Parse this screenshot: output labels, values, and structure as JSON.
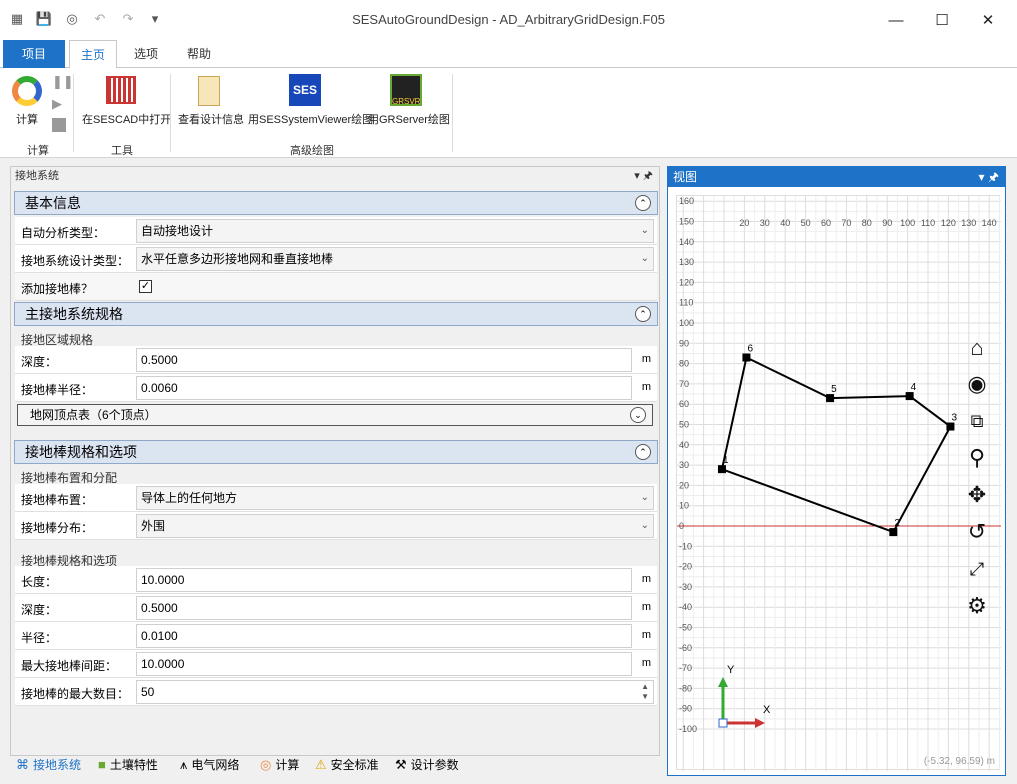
{
  "window": {
    "title": "SESAutoGroundDesign - AD_ArbitraryGridDesign.F05",
    "qa_icons": [
      "app-icon",
      "save-icon",
      "color-wheel-icon",
      "undo-icon",
      "redo-icon",
      "dropdown-icon"
    ],
    "controls": [
      "minimize",
      "maximize",
      "close"
    ]
  },
  "tabs": [
    {
      "label": "项目"
    },
    {
      "label": "主页"
    },
    {
      "label": "选项"
    },
    {
      "label": "帮助"
    }
  ],
  "ribbon": {
    "groups": [
      {
        "label": "计算",
        "buttons": [
          {
            "label": "计算"
          }
        ]
      },
      {
        "label": "工具",
        "buttons": [
          {
            "label": "在SESCAD中打开"
          }
        ]
      },
      {
        "label": "高级绘图",
        "buttons": [
          {
            "label": "查看设计信息"
          },
          {
            "label": "用SESSystemViewer绘图"
          },
          {
            "label": "用GRServer绘图"
          }
        ]
      }
    ]
  },
  "left_panel": {
    "title": "接地系统",
    "basic": {
      "title": "基本信息",
      "rows": [
        {
          "label": "自动分析类型：",
          "value": "自动接地设计"
        },
        {
          "label": "接地系统设计类型：",
          "value": "水平任意多边形接地网和垂直接地棒"
        },
        {
          "label": "添加接地棒？",
          "checked": true
        }
      ]
    },
    "main": {
      "title": "主接地系统规格",
      "subtitle": "接地区域规格",
      "rows": [
        {
          "label": "深度：",
          "value": "0.5000",
          "unit": "m"
        },
        {
          "label": "接地棒半径：",
          "value": "0.0060",
          "unit": "m"
        }
      ],
      "vertex_table": "地网顶点表（6个顶点）"
    },
    "rods": {
      "title": "接地棒规格和选项",
      "sub1": "接地棒布置和分配",
      "rows1": [
        {
          "label": "接地棒布置：",
          "value": "导体上的任何地方"
        },
        {
          "label": "接地棒分布：",
          "value": "外围"
        }
      ],
      "sub2": "接地棒规格和选项",
      "rows2": [
        {
          "label": "长度：",
          "value": "10.0000",
          "unit": "m"
        },
        {
          "label": "深度：",
          "value": "0.5000",
          "unit": "m"
        },
        {
          "label": "半径：",
          "value": "0.0100",
          "unit": "m"
        },
        {
          "label": "最大接地棒间距：",
          "value": "10.0000",
          "unit": "m"
        }
      ],
      "max_count": {
        "label": "接地棒的最大数目：",
        "value": "50"
      }
    }
  },
  "bottom_tabs": [
    {
      "label": "接地系统",
      "icon": "grid-icon"
    },
    {
      "label": "土壤特性",
      "icon": "soil-icon"
    },
    {
      "label": "电气网络",
      "icon": "tower-icon"
    },
    {
      "label": "计算",
      "icon": "color-wheel-icon"
    },
    {
      "label": "安全标准",
      "icon": "warning-icon"
    },
    {
      "label": "设计参数",
      "icon": "tools-icon"
    }
  ],
  "view": {
    "title": "视图",
    "coord_readout": "(-5.32, 96.59) m",
    "axis_x_label": "X",
    "axis_y_label": "Y",
    "chart_data": {
      "type": "scatter",
      "x_ticks": [
        20,
        30,
        40,
        50,
        60,
        70,
        80,
        90,
        100,
        110,
        120,
        130,
        140
      ],
      "y_ticks": [
        160,
        150,
        140,
        130,
        120,
        110,
        100,
        90,
        80,
        70,
        60,
        50,
        40,
        30,
        20,
        10,
        0,
        -10,
        -20,
        -30,
        -40,
        -50,
        -60,
        -70,
        -80,
        -90,
        -100
      ],
      "vertices": [
        {
          "label": "1",
          "x": 9,
          "y": 28
        },
        {
          "label": "2",
          "x": 93,
          "y": -3
        },
        {
          "label": "3",
          "x": 121,
          "y": 49
        },
        {
          "label": "4",
          "x": 101,
          "y": 64
        },
        {
          "label": "5",
          "x": 62,
          "y": 63
        },
        {
          "label": "6",
          "x": 21,
          "y": 83
        }
      ]
    },
    "nav_icons": [
      "home-icon",
      "eye-icon",
      "zoom-window-icon",
      "zoom-icon",
      "pan-icon",
      "rotate-icon",
      "fit-icon",
      "settings-icon"
    ]
  }
}
